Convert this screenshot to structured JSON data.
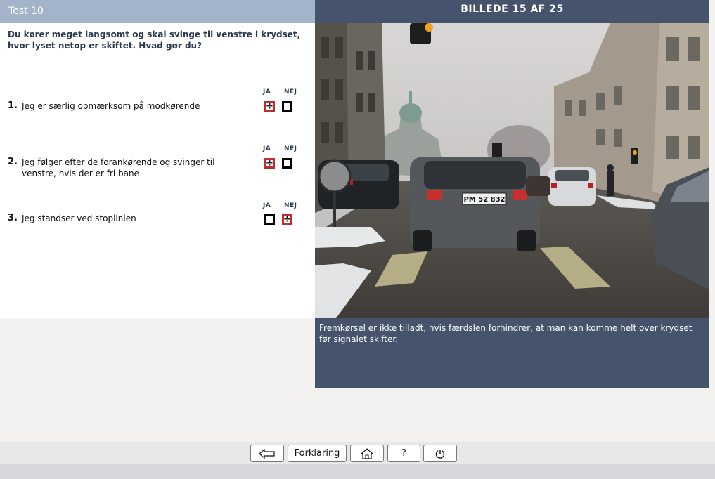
{
  "header": {
    "test_title": "Test 10",
    "image_counter": "BILLEDE 15 AF 25"
  },
  "question": {
    "text": "Du kører meget langsomt og skal svinge til venstre i krydset, hvor lyset netop er skiftet. Hvad gør du?"
  },
  "columns": {
    "yes": "JA",
    "no": "NEJ"
  },
  "answers": [
    {
      "num": "1.",
      "text": "Jeg er særlig opmærksom på modkørende",
      "yes_mark": "÷",
      "no_mark": "",
      "selected": "yes"
    },
    {
      "num": "2.",
      "text": "Jeg følger efter de forankørende og svinger til venstre, hvis der er fri bane",
      "yes_mark": "÷",
      "no_mark": "",
      "selected": "yes"
    },
    {
      "num": "3.",
      "text": "Jeg standser ved stoplinien",
      "yes_mark": "",
      "no_mark": "÷",
      "selected": "no"
    }
  ],
  "explanation": "Fremkørsel er ikke tilladt, hvis færdslen forhindrer, at man kan komme helt over krydset før signalet skifter.",
  "photo": {
    "plate": "PM 52 832"
  },
  "toolbar": {
    "back_icon": "arrow-left-icon",
    "explain_label": "Forklaring",
    "home_icon": "home-icon",
    "help_label": "?",
    "power_icon": "power-icon"
  },
  "colors": {
    "header_light": "#a3b3c9",
    "header_dark": "#45546c",
    "checked_border": "#c62b2b"
  }
}
